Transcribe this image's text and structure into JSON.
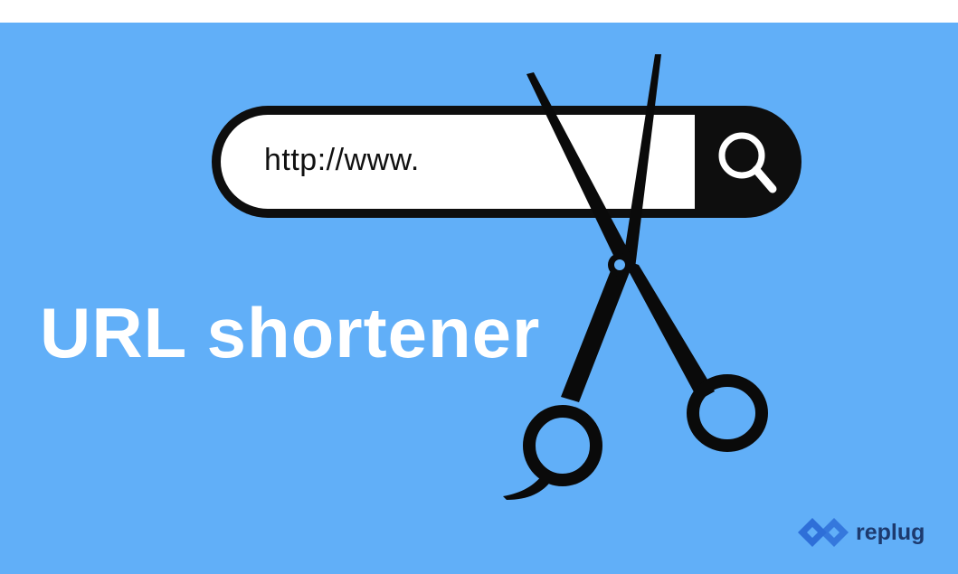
{
  "search": {
    "url_text": "http://www.",
    "button_icon": "search-icon"
  },
  "headline": "URL shortener",
  "illustration": {
    "icon": "scissors-icon"
  },
  "brand": {
    "name": "replug",
    "icon": "replug-logo-icon"
  },
  "colors": {
    "background": "#61aff8",
    "search_bar": "#0e0e0e",
    "headline": "#ffffff",
    "brand_text": "#1d3a6e",
    "brand_mark": "#2e6fd8"
  }
}
